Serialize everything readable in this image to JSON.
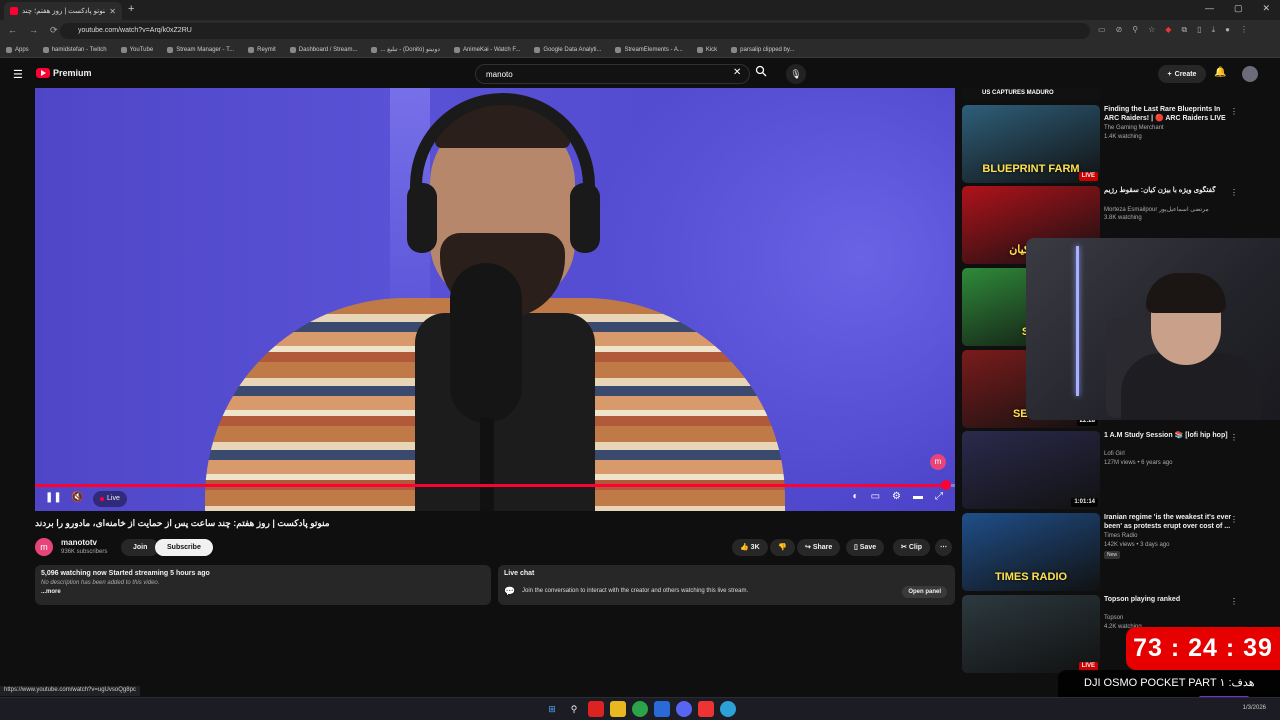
{
  "browser": {
    "tab_title": "منوتو پادکست | روز هفتم؛ چند ...",
    "new_tab_glyph": "+",
    "url": "youtube.com/watch?v=Arq/k0xZ2RU",
    "status_url": "https://www.youtube.com/watch?v=ugUvsoQg8pc",
    "bookmarks": [
      "Apps",
      "hamidstefan - Twitch",
      "YouTube",
      "Stream Manager - T...",
      "Reymit",
      "Dashboard / Stream...",
      "... تبلیغ - (Donito) دونیتو",
      "AnimeKai - Watch F...",
      "Google Data Analyti...",
      "StreamElements - A...",
      "Kick",
      "parsalip clipped by..."
    ]
  },
  "masthead": {
    "logo_label": "Premium",
    "search_value": "manoto",
    "create_label": "Create"
  },
  "player": {
    "live_label": "Live",
    "progress_fraction": 0.99,
    "watermark_letter": "m"
  },
  "video": {
    "title": "منوتو پادکست | روز هفتم: چند ساعت پس از حمایت از خامنه‌ای، مادورو را بردند",
    "channel_name": "manototv",
    "channel_letter": "m",
    "subscribers": "936K subscribers",
    "join_label": "Join",
    "subscribe_label": "Subscribe",
    "likes": "3K",
    "share_label": "Share",
    "save_label": "Save",
    "clip_label": "Clip"
  },
  "description": {
    "stats": "5,096 watching now  Started streaming 5 hours ago",
    "empty_text": "No description has been added to this video.",
    "more_label": "...more"
  },
  "chat": {
    "header": "Live chat",
    "message": "Join the conversation to interact with the creator and others watching this live stream.",
    "open_panel_label": "Open panel"
  },
  "sidebar": {
    "items": [
      {
        "title": "Finding the Last Rare Blueprints In ARC Raiders! | 🔴 ARC Raiders LIVE",
        "channel": "The Gaming Merchant",
        "meta": "1.4K watching",
        "badge": "LIVE",
        "thumb_color": "#2e5f7a",
        "thumb_text": "BLUEPRINT FARM"
      },
      {
        "title": "گفتگوی ویژه با بیژن کیان: سقوط رژیم",
        "channel": "Morteza Esmailpour مرتضی اسماعیل‌پور",
        "meta": "3.8K watching",
        "badge": "",
        "thumb_color": "#b0121b",
        "thumb_text": "بیژن کیان"
      },
      {
        "title": "",
        "channel": "",
        "meta": "",
        "badge": "",
        "thumb_color": "#2f8a3a",
        "thumb_text": "SKI"
      },
      {
        "title": "",
        "channel": "",
        "meta": "",
        "badge": "22:28",
        "thumb_color": "#7a1b1b",
        "thumb_text": "SE7EN"
      },
      {
        "title": "1 A.M Study Session 📚 [lofi hip hop]",
        "channel": "Lofi Girl",
        "meta": "127M views • 6 years ago",
        "badge": "1:01:14",
        "thumb_color": "#2b2a4d",
        "thumb_text": ""
      },
      {
        "title": "Iranian regime 'is the weakest it's ever been' as protests erupt over cost of ...",
        "channel": "Times Radio",
        "meta": "142K views • 3 days ago",
        "new_label": "New",
        "badge": "",
        "thumb_color": "#1f4f8a",
        "thumb_text": "TIMES RADIO"
      },
      {
        "title": "Topson playing ranked",
        "channel": "Topson",
        "meta": "4.2K watching",
        "badge": "LIVE",
        "thumb_color": "#2c3a3f",
        "thumb_text": ""
      }
    ],
    "top_partial_text": "US CAPTURES MADURO"
  },
  "overlay": {
    "countdown": "73 : 24 : 39",
    "goal_text": "DJI OSMO POCKET PART ۱ :هدف"
  },
  "taskbar": {
    "date": "1/3/2026"
  }
}
